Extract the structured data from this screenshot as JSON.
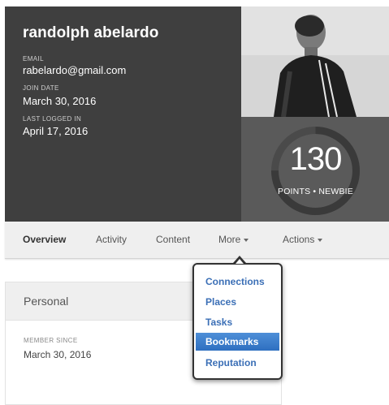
{
  "profile": {
    "name": "randolph abelardo",
    "email_label": "EMAIL",
    "email": "rabelardo@gmail.com",
    "join_label": "JOIN DATE",
    "join_date": "March 30, 2016",
    "last_label": "LAST LOGGED IN",
    "last_logged": "April 17, 2016",
    "points": "130",
    "points_caption": "POINTS • NEWBIE",
    "points_progress": 0.75
  },
  "tabs": [
    {
      "label": "Overview"
    },
    {
      "label": "Activity"
    },
    {
      "label": "Content"
    },
    {
      "label": "More"
    },
    {
      "label": "Actions"
    }
  ],
  "more_menu": {
    "items": [
      {
        "label": "Connections"
      },
      {
        "label": "Places"
      },
      {
        "label": "Tasks"
      },
      {
        "label": "Bookmarks"
      },
      {
        "label": "Reputation"
      }
    ],
    "selected": "Bookmarks"
  },
  "personal": {
    "title": "Personal",
    "member_label": "MEMBER SINCE",
    "member_since": "March 30, 2016"
  },
  "colors": {
    "card_bg": "#3f3f3f",
    "points_bg": "#5a5a5a",
    "link_blue": "#3b6fb6",
    "highlight_blue": "#2e6fc0"
  }
}
